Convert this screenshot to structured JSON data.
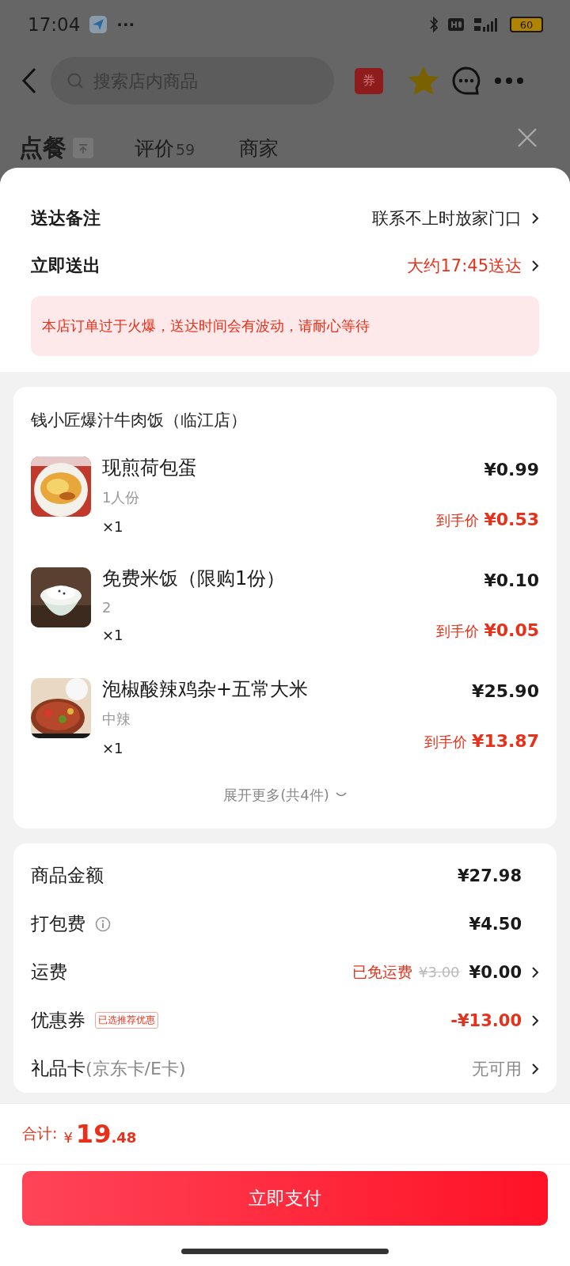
{
  "status_bar": {
    "time": "17:04",
    "more": "···",
    "battery": "60"
  },
  "nav": {
    "search_placeholder": "搜索店内商品",
    "coupon": "券",
    "favorited": true
  },
  "store_tabs": [
    {
      "label": "点餐",
      "selected": true
    },
    {
      "label": "评价",
      "count": "59",
      "selected": false
    },
    {
      "label": "商家",
      "selected": false
    }
  ],
  "delivery": {
    "rows": [
      {
        "label": "送达备注",
        "value": "联系不上时放家门口",
        "highlight": false
      },
      {
        "label": "立即送出",
        "value": "大约17:45送达",
        "highlight": true
      }
    ],
    "notice": "本店订单过于火爆，送达时间会有波动，请耐心等待"
  },
  "order": {
    "store": "钱小匠爆汁牛肉饭（临江店）",
    "items": [
      {
        "name": "现煎荷包蛋",
        "spec": "1人份",
        "quantity": "×1",
        "price": "¥0.99",
        "final_label": "到手价",
        "final_price": "¥0.53"
      },
      {
        "name": "免费米饭（限购1份）",
        "spec": "2",
        "quantity": "×1",
        "price": "¥0.10",
        "final_label": "到手价",
        "final_price": "¥0.05"
      },
      {
        "name": "泡椒酸辣鸡杂+五常大米",
        "spec": "中辣",
        "quantity": "×1",
        "price": "¥25.90",
        "final_label": "到手价",
        "final_price": "¥13.87"
      }
    ],
    "expand": "展开更多(共4件)"
  },
  "costs": [
    {
      "kind": "plain",
      "label": "商品金额",
      "value": "¥27.98"
    },
    {
      "kind": "info",
      "label": "打包费",
      "value": "¥4.50"
    },
    {
      "kind": "shipping",
      "label": "运费",
      "free_label": "已免运费",
      "original_price": "¥3.00",
      "value": "¥0.00"
    },
    {
      "kind": "coupon",
      "label": "优惠券",
      "tag": "已选推荐优惠",
      "value": "-¥13.00"
    },
    {
      "kind": "giftcard",
      "label": "礼品卡",
      "label_note": "(京东卡/E卡)",
      "value": "无可用"
    }
  ],
  "footer": {
    "total_label": "合计:",
    "currency": "¥",
    "integer": "19",
    "decimal": ".48",
    "pay_button": "立即支付"
  }
}
